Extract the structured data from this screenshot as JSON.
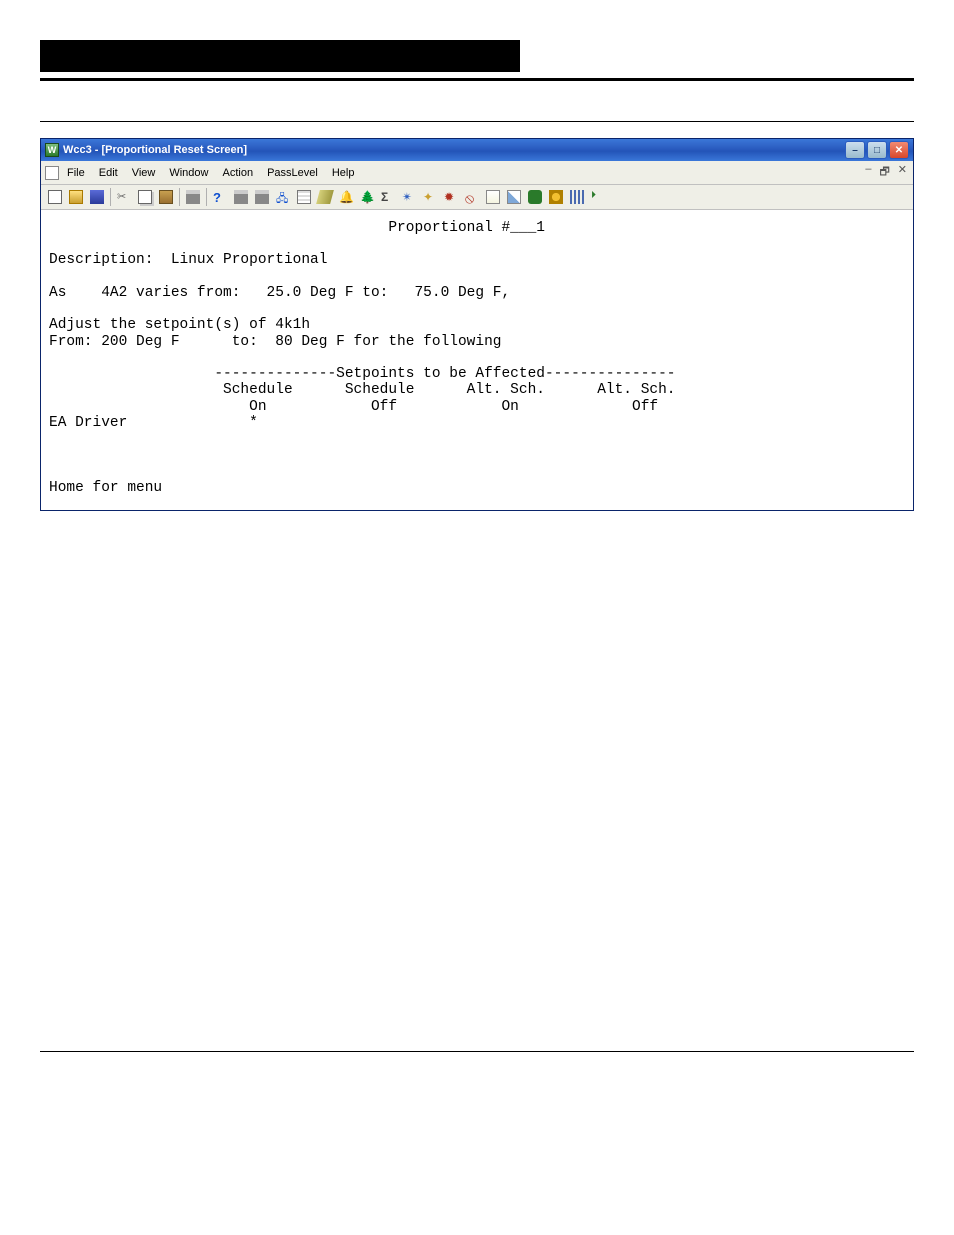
{
  "window": {
    "title": "Wcc3 - [Proportional Reset Screen]"
  },
  "menu": {
    "items": [
      "File",
      "Edit",
      "View",
      "Window",
      "Action",
      "PassLevel",
      "Help"
    ]
  },
  "toolbar": {
    "icons": [
      "new",
      "open",
      "save",
      "cut",
      "copy",
      "paste",
      "print",
      "help",
      "print-q1",
      "print-q2",
      "dir",
      "stack",
      "tag",
      "bell",
      "tree",
      "sigma",
      "wand",
      "spark",
      "bug",
      "stop",
      "note",
      "chart",
      "badge",
      "dot",
      "hist",
      "chev"
    ]
  },
  "terminal": {
    "title_line": "                                       Proportional #___1",
    "blank": "",
    "desc_line": "Description:  Linux Proportional",
    "as_line": "As    4A2 varies from:   25.0 Deg F to:   75.0 Deg F,",
    "adjust_line": "Adjust the setpoint(s) of 4k1h",
    "from_line": "From: 200 Deg F      to:  80 Deg F for the following",
    "sp_header": "                   --------------Setpoints to be Affected---------------",
    "sp_cols1": "                    Schedule      Schedule      Alt. Sch.      Alt. Sch.",
    "sp_cols2": "                       On            Off            On             Off",
    "sp_row": "EA Driver              *",
    "home": "Home for menu"
  },
  "footer": {
    "left": "",
    "right": ""
  }
}
